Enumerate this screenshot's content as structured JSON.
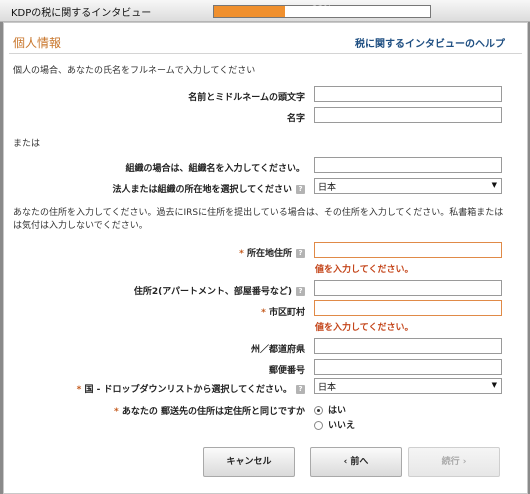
{
  "window": {
    "title": "KDPの税に関するインタビュー"
  },
  "progress": {
    "text": "33%",
    "value": 0.33
  },
  "header": {
    "section_title": "個人情報",
    "help_link": "税に関するインタビューのヘルプ"
  },
  "intro": "個人の場合、あなたの氏名をフルネームで入力してください",
  "fields": {
    "middle_initial": {
      "label": "名前とミドルネームの頭文字",
      "value": ""
    },
    "last_name": {
      "label": "名字",
      "value": ""
    },
    "or_text": "または",
    "org_name": {
      "label": "組織の場合は、組織名を入力してください。",
      "value": ""
    },
    "org_location": {
      "label": "法人または組織の所在地を選択してください",
      "help": "?",
      "selected": "日本"
    },
    "address_note": "あなたの住所を入力してください。過去にIRSに住所を提出している場合は、その住所を入力してください。私書箱またはは気付は入力しないでください。",
    "address1": {
      "required": "*",
      "label": "所在地住所",
      "help": "?",
      "value": "",
      "error": "値を入力してください。"
    },
    "address2": {
      "label": "住所2(アパートメント、部屋番号など)",
      "help": "?",
      "value": ""
    },
    "city": {
      "required": "*",
      "label": "市区町村",
      "value": "",
      "error": "値を入力してください。"
    },
    "state": {
      "label": "州／都道府県",
      "value": ""
    },
    "postal": {
      "label": "郵便番号",
      "value": ""
    },
    "country": {
      "required": "*",
      "label": "国 - ドロップダウンリストから選択してください。",
      "help": "?",
      "selected": "日本"
    },
    "same_address": {
      "required": "*",
      "label": "あなたの 郵送先の住所は定住所と同じですか",
      "yes": "はい",
      "no": "いいえ"
    }
  },
  "buttons": {
    "cancel": "キャンセル",
    "back": "前へ",
    "next": "続行",
    "back_icon": "chevron-left-icon",
    "next_icon": "chevron-right-icon"
  }
}
